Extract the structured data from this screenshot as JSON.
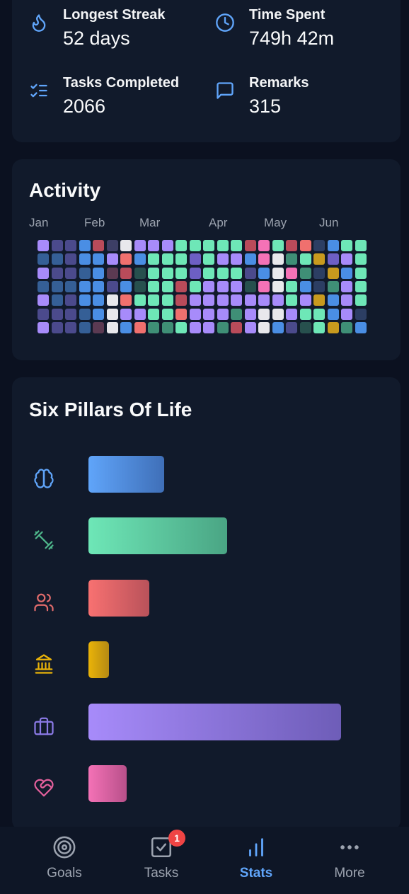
{
  "stats": {
    "longest_streak": {
      "label": "Longest Streak",
      "value": "52 days",
      "icon": "flame-icon"
    },
    "time_spent": {
      "label": "Time Spent",
      "value": "749h 42m",
      "icon": "clock-icon"
    },
    "tasks_completed": {
      "label": "Tasks Completed",
      "value": "2066",
      "icon": "checklist-icon"
    },
    "remarks": {
      "label": "Remarks",
      "value": "315",
      "icon": "comment-icon"
    }
  },
  "activity": {
    "title": "Activity",
    "months": [
      "Jan",
      "Feb",
      "Mar",
      "Apr",
      "May",
      "Jun"
    ],
    "palette": {
      "P": "#a78bfa",
      "p": "#6d5fc4",
      "i": "#4b4a8c",
      "s": "#355f96",
      "b": "#4a8ee4",
      "r": "#b94b5a",
      "m": "#5b3a52",
      "d": "#3d3f66",
      "w": "#e8e8ec",
      "c": "#f0706e",
      "g": "#6ee7b7",
      "G": "#3f8f76",
      "D": "#27504e",
      "y": "#c89a1e",
      "k": "#f472b6",
      "n": "#2c3e63"
    },
    "weeks": [
      "PsPsPiP",
      "isissii",
      "iiisiii",
      "bbsbbss",
      "rbbbbbm",
      "dPmiwww",
      "wcrbcPb",
      "PbDDgPc",
      "PgggggG",
      "PgggggG",
      "gggrrcg",
      "gppgPPP",
      "gggPPPP",
      "gPgPPPG",
      "gPgPPGr",
      "rbiDPPP",
      "kkbkPww",
      "gwwwPwb",
      "rGkggPi",
      "cgGbPgD",
      "nynnygg",
      "bpyGbby",
      "gPbPPPG",
      "gggggnb"
    ]
  },
  "pillars": {
    "title": "Six Pillars Of Life",
    "items": [
      {
        "name": "mind",
        "icon": "brain-icon",
        "value": 0.3,
        "color_from": "#60a5fa",
        "color_to": "#3f6fb8"
      },
      {
        "name": "fitness",
        "icon": "dumbbell-icon",
        "value": 0.55,
        "color_from": "#6ee7b7",
        "color_to": "#4aa584"
      },
      {
        "name": "relationships",
        "icon": "users-icon",
        "value": 0.24,
        "color_from": "#f87171",
        "color_to": "#b9525a"
      },
      {
        "name": "finance",
        "icon": "bank-icon",
        "value": 0.08,
        "color_from": "#eab308",
        "color_to": "#b58a14"
      },
      {
        "name": "career",
        "icon": "briefcase-icon",
        "value": 1.0,
        "color_from": "#a78bfa",
        "color_to": "#6e5db8"
      },
      {
        "name": "emotional",
        "icon": "heart-handshake-icon",
        "value": 0.15,
        "color_from": "#f472b6",
        "color_to": "#b8508a"
      }
    ]
  },
  "nav": {
    "goals": {
      "label": "Goals",
      "icon": "target-icon"
    },
    "tasks": {
      "label": "Tasks",
      "icon": "checkbox-icon",
      "badge": "1"
    },
    "stats": {
      "label": "Stats",
      "icon": "bar-chart-icon",
      "active": true
    },
    "more": {
      "label": "More",
      "icon": "more-dots-icon"
    }
  }
}
